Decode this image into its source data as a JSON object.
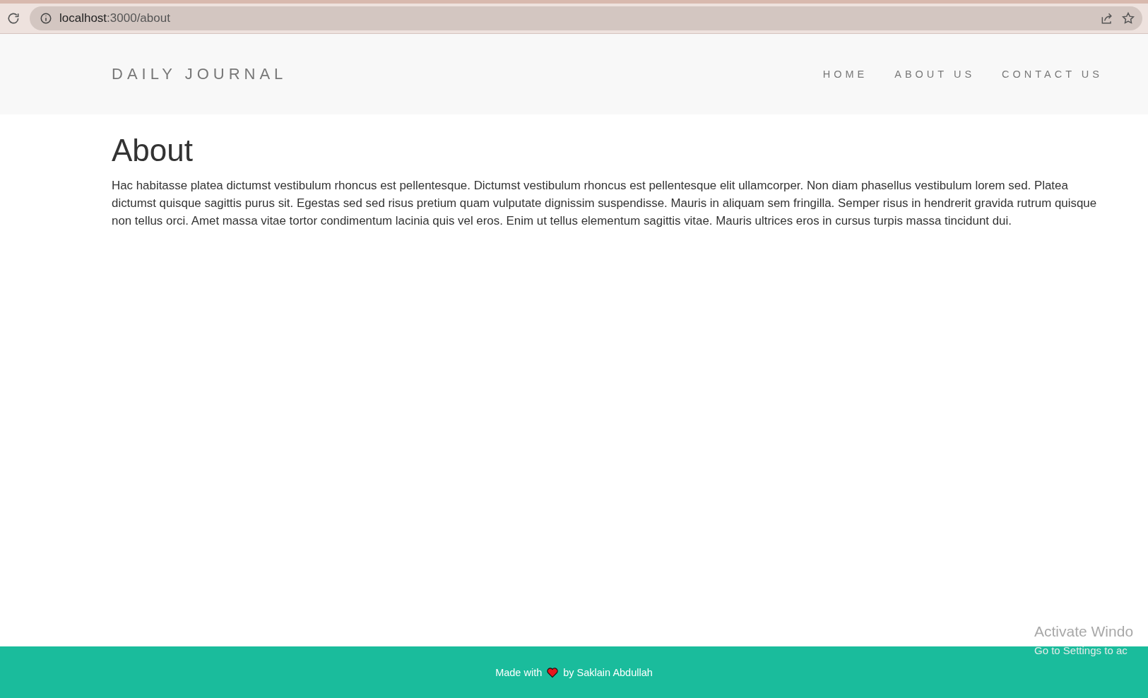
{
  "browser": {
    "url_host": "localhost",
    "url_path": ":3000/about"
  },
  "navbar": {
    "brand": "DAILY JOURNAL",
    "links": [
      {
        "label": "HOME",
        "selected": false
      },
      {
        "label": "ABOUT US",
        "selected": false
      },
      {
        "label": "CONTACT US",
        "selected": false
      }
    ]
  },
  "content": {
    "heading": "About",
    "paragraph": "Hac habitasse platea dictumst vestibulum rhoncus est pellentesque. Dictumst vestibulum rhoncus est pellentesque elit ullamcorper. Non diam phasellus vestibulum lorem sed. Platea dictumst quisque sagittis purus sit. Egestas sed sed risus pretium quam vulputate dignissim suspendisse. Mauris in aliquam sem fringilla. Semper risus in hendrerit gravida rutrum quisque non tellus orci. Amet massa vitae tortor condimentum lacinia quis vel eros. Enim ut tellus elementum sagittis vitae. Mauris ultrices eros in cursus turpis massa tincidunt dui."
  },
  "footer": {
    "before": "Made with",
    "after": "by Saklain Abdullah"
  },
  "activation_notice": {
    "title": "Activate Windo",
    "subtitle": "Go to Settings to ac"
  }
}
